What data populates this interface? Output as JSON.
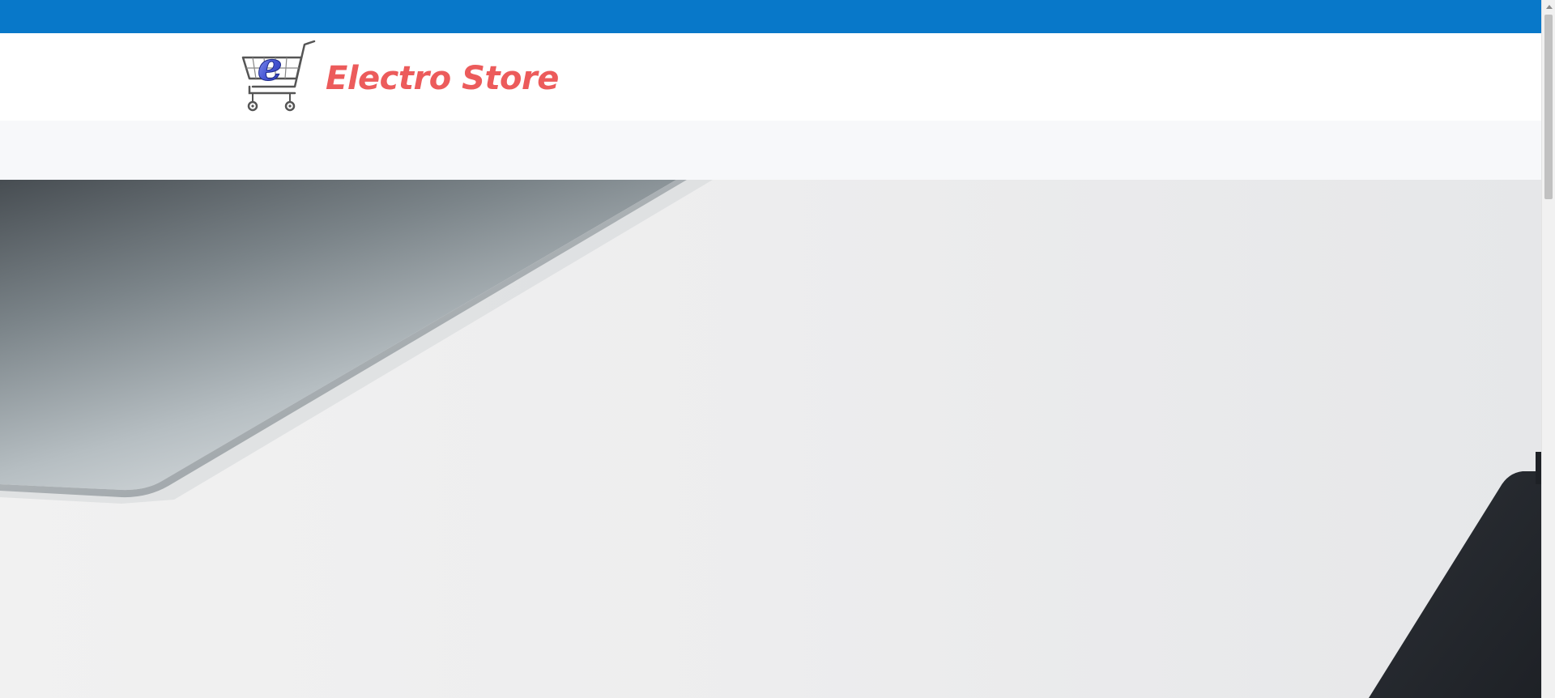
{
  "brand": {
    "name": "Electro Store",
    "logo_letter": "e",
    "logo_icon": "shopping-cart-icon",
    "name_color": "#ec5b5b"
  },
  "colors": {
    "topbar": "#0878c9",
    "header_bg": "#ffffff",
    "navbar_bg": "#f7f8fa"
  },
  "hero": {
    "image": "laptop-on-white-desk-photo"
  }
}
